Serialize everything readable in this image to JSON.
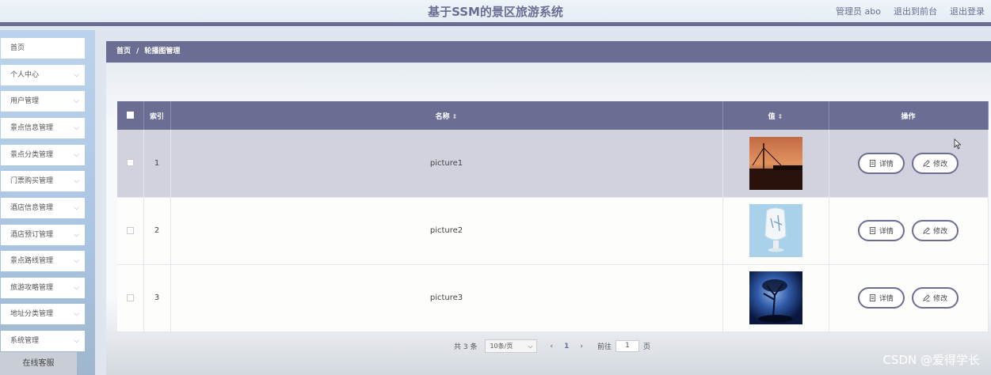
{
  "header": {
    "title": "基于SSM的景区旅游系统",
    "admin_label": "管理员 abo",
    "back_link": "退出到前台",
    "logout_link": "退出登录"
  },
  "sidebar": {
    "items": [
      {
        "label": "首页",
        "has_chevron": false
      },
      {
        "label": "个人中心",
        "has_chevron": true
      },
      {
        "label": "用户管理",
        "has_chevron": true
      },
      {
        "label": "景点信息管理",
        "has_chevron": true
      },
      {
        "label": "景点分类管理",
        "has_chevron": true
      },
      {
        "label": "门票购买管理",
        "has_chevron": true
      },
      {
        "label": "酒店信息管理",
        "has_chevron": true
      },
      {
        "label": "酒店预订管理",
        "has_chevron": true
      },
      {
        "label": "景点路线管理",
        "has_chevron": true
      },
      {
        "label": "旅游攻略管理",
        "has_chevron": true
      },
      {
        "label": "地址分类管理",
        "has_chevron": true
      },
      {
        "label": "系统管理",
        "has_chevron": true
      }
    ],
    "chat_label": "在线客服"
  },
  "breadcrumb": {
    "home": "首页",
    "separator": "/",
    "current": "轮播图管理"
  },
  "table": {
    "columns": {
      "index": "索引",
      "name": "名称",
      "value": "值",
      "actions": "操作"
    },
    "rows": [
      {
        "index": "1",
        "name": "picture1",
        "image": "sunset-pier"
      },
      {
        "index": "2",
        "name": "picture2",
        "image": "ice-sculpture"
      },
      {
        "index": "3",
        "name": "picture3",
        "image": "night-tree"
      }
    ],
    "detail_label": "详情",
    "edit_label": "修改"
  },
  "pagination": {
    "total": "共 3 条",
    "page_size": "10条/页",
    "current_page": "1",
    "goto_label": "前往",
    "goto_value": "1",
    "page_suffix": "页"
  },
  "watermark": "CSDN @爱得学长",
  "colors": {
    "accent": "#6b6d93",
    "selected_row": "#d1d2de"
  }
}
